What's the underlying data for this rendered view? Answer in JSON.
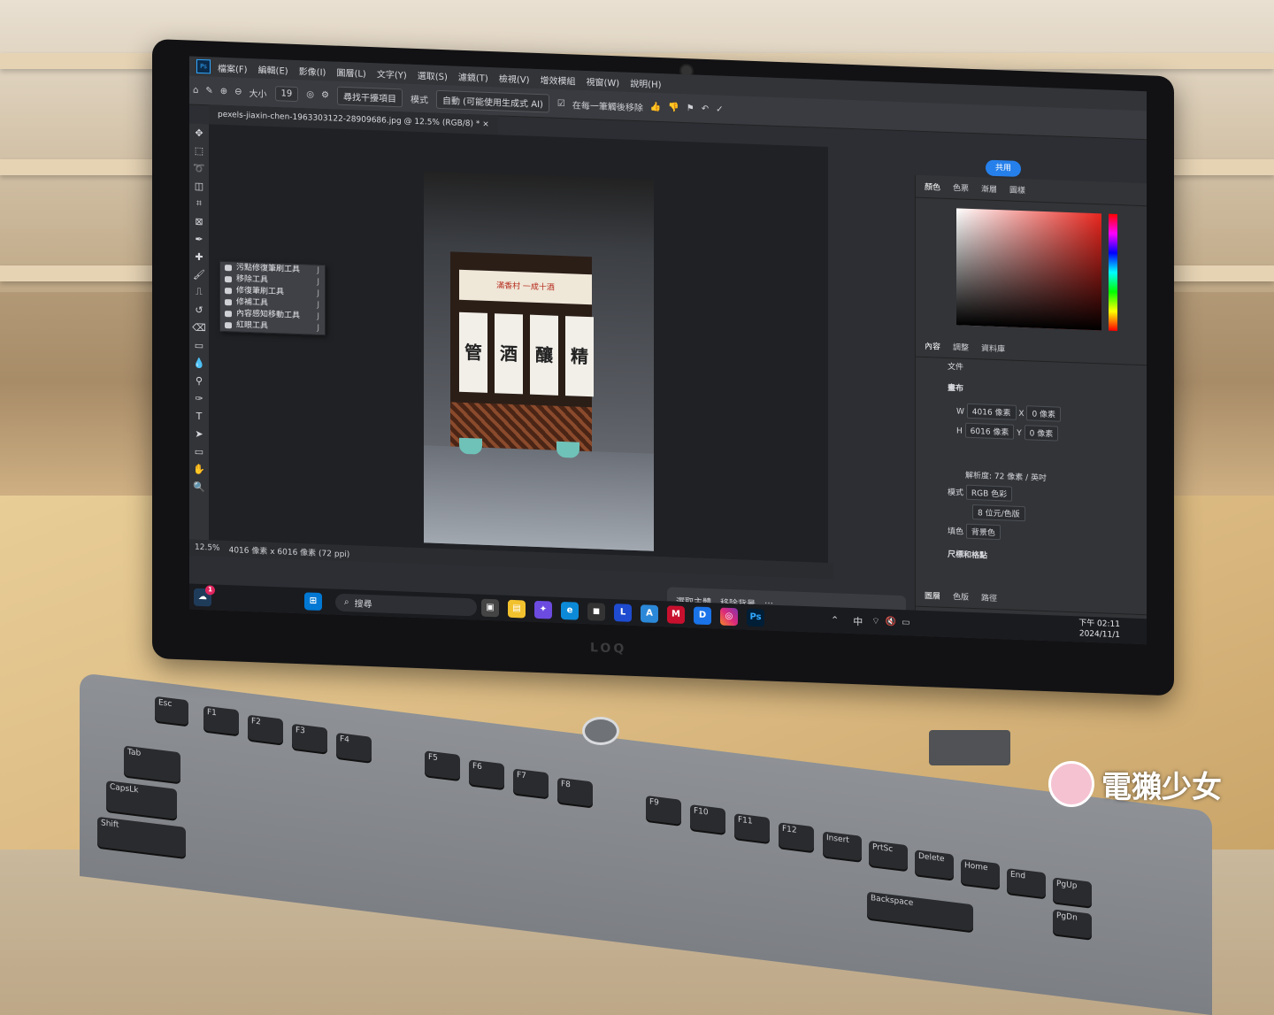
{
  "app": {
    "menu": [
      "檔案(F)",
      "編輯(E)",
      "影像(I)",
      "圖層(L)",
      "文字(Y)",
      "選取(S)",
      "濾鏡(T)",
      "檢視(V)",
      "增效模組",
      "視窗(W)",
      "說明(H)"
    ]
  },
  "options": {
    "size_label": "大小",
    "size_value": "19",
    "find_distractions": "尋找干擾項目",
    "mode_label": "模式",
    "mode_value": "自動 (可能使用生成式 AI)",
    "remove_after_stroke": "在每一筆觸後移除"
  },
  "document": {
    "tab_title": "pexels-jiaxin-chen-1963303122-28909686.jpg @ 12.5% (RGB/8) *",
    "zoom": "12.5%",
    "dimensions": "4016 像素 x 6016 像素 (72 ppi)"
  },
  "tool_flyout": [
    {
      "label": "污點修復筆刷工具",
      "key": "J"
    },
    {
      "label": "移除工具",
      "key": "J"
    },
    {
      "label": "修復筆刷工具",
      "key": "J"
    },
    {
      "label": "修補工具",
      "key": "J"
    },
    {
      "label": "內容感知移動工具",
      "key": "J"
    },
    {
      "label": "紅眼工具",
      "key": "J"
    }
  ],
  "context_taskbar": {
    "select_subject": "選取主體",
    "remove_background": "移除背景"
  },
  "share_button": "共用",
  "color_tabs": [
    "顏色",
    "色票",
    "漸層",
    "圖樣"
  ],
  "props_tabs": [
    "內容",
    "調整",
    "資料庫"
  ],
  "properties": {
    "doc_label": "文件",
    "canvas_heading": "畫布",
    "w_label": "W",
    "w_value": "4016 像素",
    "h_label": "H",
    "h_value": "6016 像素",
    "x_label": "X",
    "x_placeholder": "0 像素",
    "y_label": "Y",
    "y_placeholder": "0 像素",
    "resolution": "解析度: 72 像素 / 英吋",
    "mode_label": "模式",
    "mode_value": "RGB 色彩",
    "bit_depth": "8 位元/色版",
    "fill_label": "填色",
    "fill_value": "背景色",
    "rulers_heading": "尺標和格點"
  },
  "bottom_tabs": [
    "圖層",
    "色版",
    "路徑"
  ],
  "photo_text": {
    "panel1": "管",
    "panel2": "酒",
    "panel3": "釀",
    "panel4": "精",
    "sign": "滿香村 一成十酒"
  },
  "windows": {
    "search_placeholder": "搜尋",
    "ime": "中",
    "time": "下午 02:11",
    "date": "2024/11/1",
    "notification_badge": "1"
  },
  "keyboard": {
    "row0": [
      "Esc",
      "F1",
      "F2",
      "F3",
      "F4",
      "F5",
      "F6",
      "F7",
      "F8",
      "F9",
      "F10",
      "F11",
      "F12",
      "Insert",
      "PrtSc",
      "Delete",
      "Home",
      "End",
      "PgUp",
      "PgDn"
    ],
    "tab": "Tab",
    "caps": "CapsLk",
    "shift": "Shift",
    "backspace": "Backspace"
  },
  "watermark": "電獺少女",
  "colors": {
    "accent": "#2680eb",
    "ps_blue": "#31a8ff"
  }
}
